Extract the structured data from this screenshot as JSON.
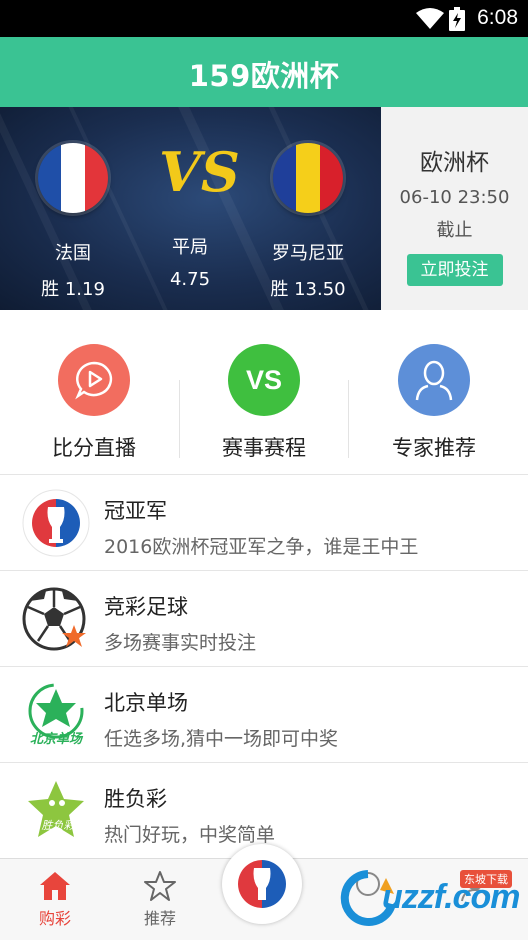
{
  "status_bar": {
    "time": "6:08"
  },
  "app_bar": {
    "title": "159欧洲杯"
  },
  "match": {
    "home": {
      "name": "法国",
      "odds": "胜 1.19"
    },
    "vs_text": "VS",
    "draw": {
      "name": "平局",
      "odds": "4.75"
    },
    "away": {
      "name": "罗马尼亚",
      "odds": "胜 13.50"
    }
  },
  "match_side": {
    "title": "欧洲杯",
    "datetime": "06-10 23:50",
    "deadline": "截止",
    "bet_button": "立即投注"
  },
  "quick_menu": [
    {
      "label": "比分直播",
      "icon": "play-icon",
      "color": "#f26d5f"
    },
    {
      "label": "赛事赛程",
      "icon_text": "VS",
      "icon": "vs-icon",
      "color": "#3fbf3f"
    },
    {
      "label": "专家推荐",
      "icon": "expert-user-icon",
      "color": "#5d8fd8"
    }
  ],
  "list": [
    {
      "title": "冠亚军",
      "subtitle": "2016欧洲杯冠亚军之争，谁是王中王",
      "icon": "euro-trophy-icon"
    },
    {
      "title": "竞彩足球",
      "subtitle": "多场赛事实时投注",
      "icon": "soccer-ball-icon"
    },
    {
      "title": "北京单场",
      "subtitle": "任选多场,猜中一场即可中奖",
      "icon": "beijing-single-icon",
      "icon_text": "北京单场"
    },
    {
      "title": "胜负彩",
      "subtitle": "热门好玩，中奖简单",
      "icon": "win-lose-icon",
      "icon_text": "胜负彩"
    }
  ],
  "tab_bar": {
    "tabs": [
      {
        "label": "购彩",
        "icon": "home-icon",
        "active": true
      },
      {
        "label": "推荐",
        "icon": "star-icon",
        "active": false
      },
      {
        "label": "",
        "icon": "euro-logo-icon",
        "active": false
      },
      {
        "label": "",
        "icon": "search-icon",
        "active": false
      },
      {
        "label": "",
        "icon": "user-icon",
        "active": false
      }
    ]
  },
  "watermark": {
    "text": "uzzf.com",
    "badge": "东坡下载"
  },
  "colors": {
    "primary": "#3ac393",
    "active_tab": "#e8453c",
    "vs_yellow": "#f2c91a"
  }
}
